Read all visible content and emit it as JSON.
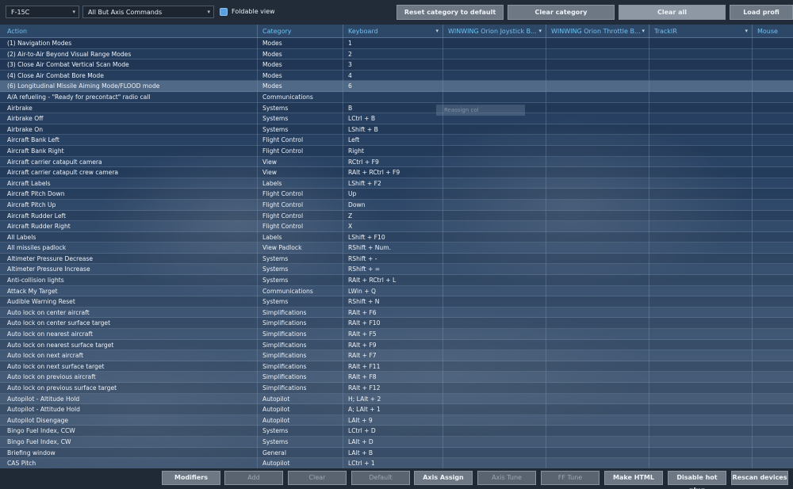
{
  "toolbar": {
    "aircraft_select": "F-15C",
    "filter_select": "All But Axis Commands",
    "foldable_label": "Foldable view",
    "reset_category": "Reset category to default",
    "clear_category": "Clear category",
    "clear_all": "Clear all",
    "load_profile": "Load profi"
  },
  "columns": {
    "action": "Action",
    "category": "Category",
    "keyboard": "Keyboard",
    "device1": "WINWING Orion Joystick B...",
    "device2": "WINWING Orion Throttle B...",
    "device3": "TrackIR",
    "device4": "Mouse"
  },
  "ghost_label": "Reassign col",
  "rows": [
    {
      "action": "(1) Navigation Modes",
      "category": "Modes",
      "key": "1"
    },
    {
      "action": "(2) Air-to-Air Beyond Visual Range Modes",
      "category": "Modes",
      "key": "2"
    },
    {
      "action": "(3) Close Air Combat Vertical Scan Mode",
      "category": "Modes",
      "key": "3"
    },
    {
      "action": "(4) Close Air Combat Bore Mode",
      "category": "Modes",
      "key": "4"
    },
    {
      "action": "(6) Longitudinal Missile Aiming Mode/FLOOD mode",
      "category": "Modes",
      "key": "6"
    },
    {
      "action": "A/A refueling - \"Ready for precontact\" radio call",
      "category": "Communications",
      "key": ""
    },
    {
      "action": "Airbrake",
      "category": "Systems",
      "key": "B"
    },
    {
      "action": "Airbrake Off",
      "category": "Systems",
      "key": "LCtrl + B"
    },
    {
      "action": "Airbrake On",
      "category": "Systems",
      "key": "LShift + B"
    },
    {
      "action": "Aircraft Bank Left",
      "category": "Flight Control",
      "key": "Left"
    },
    {
      "action": "Aircraft Bank Right",
      "category": "Flight Control",
      "key": "Right"
    },
    {
      "action": "Aircraft carrier catapult camera",
      "category": "View",
      "key": "RCtrl + F9"
    },
    {
      "action": "Aircraft carrier catapult crew camera",
      "category": "View",
      "key": "RAlt + RCtrl + F9"
    },
    {
      "action": "Aircraft Labels",
      "category": "Labels",
      "key": "LShift + F2"
    },
    {
      "action": "Aircraft Pitch Down",
      "category": "Flight Control",
      "key": "Up"
    },
    {
      "action": "Aircraft Pitch Up",
      "category": "Flight Control",
      "key": "Down"
    },
    {
      "action": "Aircraft Rudder Left",
      "category": "Flight Control",
      "key": "Z"
    },
    {
      "action": "Aircraft Rudder Right",
      "category": "Flight Control",
      "key": "X"
    },
    {
      "action": "All Labels",
      "category": "Labels",
      "key": "LShift + F10"
    },
    {
      "action": "All missiles padlock",
      "category": "View Padlock",
      "key": "RShift + Num."
    },
    {
      "action": "Altimeter Pressure Decrease",
      "category": "Systems",
      "key": "RShift + -"
    },
    {
      "action": "Altimeter Pressure Increase",
      "category": "Systems",
      "key": "RShift + ="
    },
    {
      "action": "Anti-collision lights",
      "category": "Systems",
      "key": "RAlt + RCtrl + L"
    },
    {
      "action": "Attack My Target",
      "category": "Communications",
      "key": "LWin + Q"
    },
    {
      "action": "Audible Warning Reset",
      "category": "Systems",
      "key": "RShift + N"
    },
    {
      "action": "Auto lock on center aircraft",
      "category": "Simplifications",
      "key": "RAlt + F6"
    },
    {
      "action": "Auto lock on center surface target",
      "category": "Simplifications",
      "key": "RAlt + F10"
    },
    {
      "action": "Auto lock on nearest aircraft",
      "category": "Simplifications",
      "key": "RAlt + F5"
    },
    {
      "action": "Auto lock on nearest surface target",
      "category": "Simplifications",
      "key": "RAlt + F9"
    },
    {
      "action": "Auto lock on next aircraft",
      "category": "Simplifications",
      "key": "RAlt + F7"
    },
    {
      "action": "Auto lock on next surface target",
      "category": "Simplifications",
      "key": "RAlt + F11"
    },
    {
      "action": "Auto lock on previous aircraft",
      "category": "Simplifications",
      "key": "RAlt + F8"
    },
    {
      "action": "Auto lock on previous surface target",
      "category": "Simplifications",
      "key": "RAlt + F12"
    },
    {
      "action": "Autopilot - Altitude Hold",
      "category": "Autopilot",
      "key": "H; LAlt + 2"
    },
    {
      "action": "Autopilot - Attitude Hold",
      "category": "Autopilot",
      "key": "A; LAlt + 1"
    },
    {
      "action": "Autopilot Disengage",
      "category": "Autopilot",
      "key": "LAlt + 9"
    },
    {
      "action": "Bingo Fuel Index, CCW",
      "category": "Systems",
      "key": "LCtrl + D"
    },
    {
      "action": "Bingo Fuel Index, CW",
      "category": "Systems",
      "key": "LAlt + D"
    },
    {
      "action": "Briefing window",
      "category": "General",
      "key": "LAlt + B"
    },
    {
      "action": "CAS Pitch",
      "category": "Autopilot",
      "key": "LCtrl + 1"
    }
  ],
  "footer": {
    "modifiers": "Modifiers",
    "add": "Add",
    "clear": "Clear",
    "default": "Default",
    "axis_assign": "Axis Assign",
    "axis_tune": "Axis Tune",
    "ff_tune": "FF Tune",
    "make_html": "Make HTML",
    "disable_hot_plug": "Disable hot plug",
    "rescan_devices": "Rescan devices"
  }
}
